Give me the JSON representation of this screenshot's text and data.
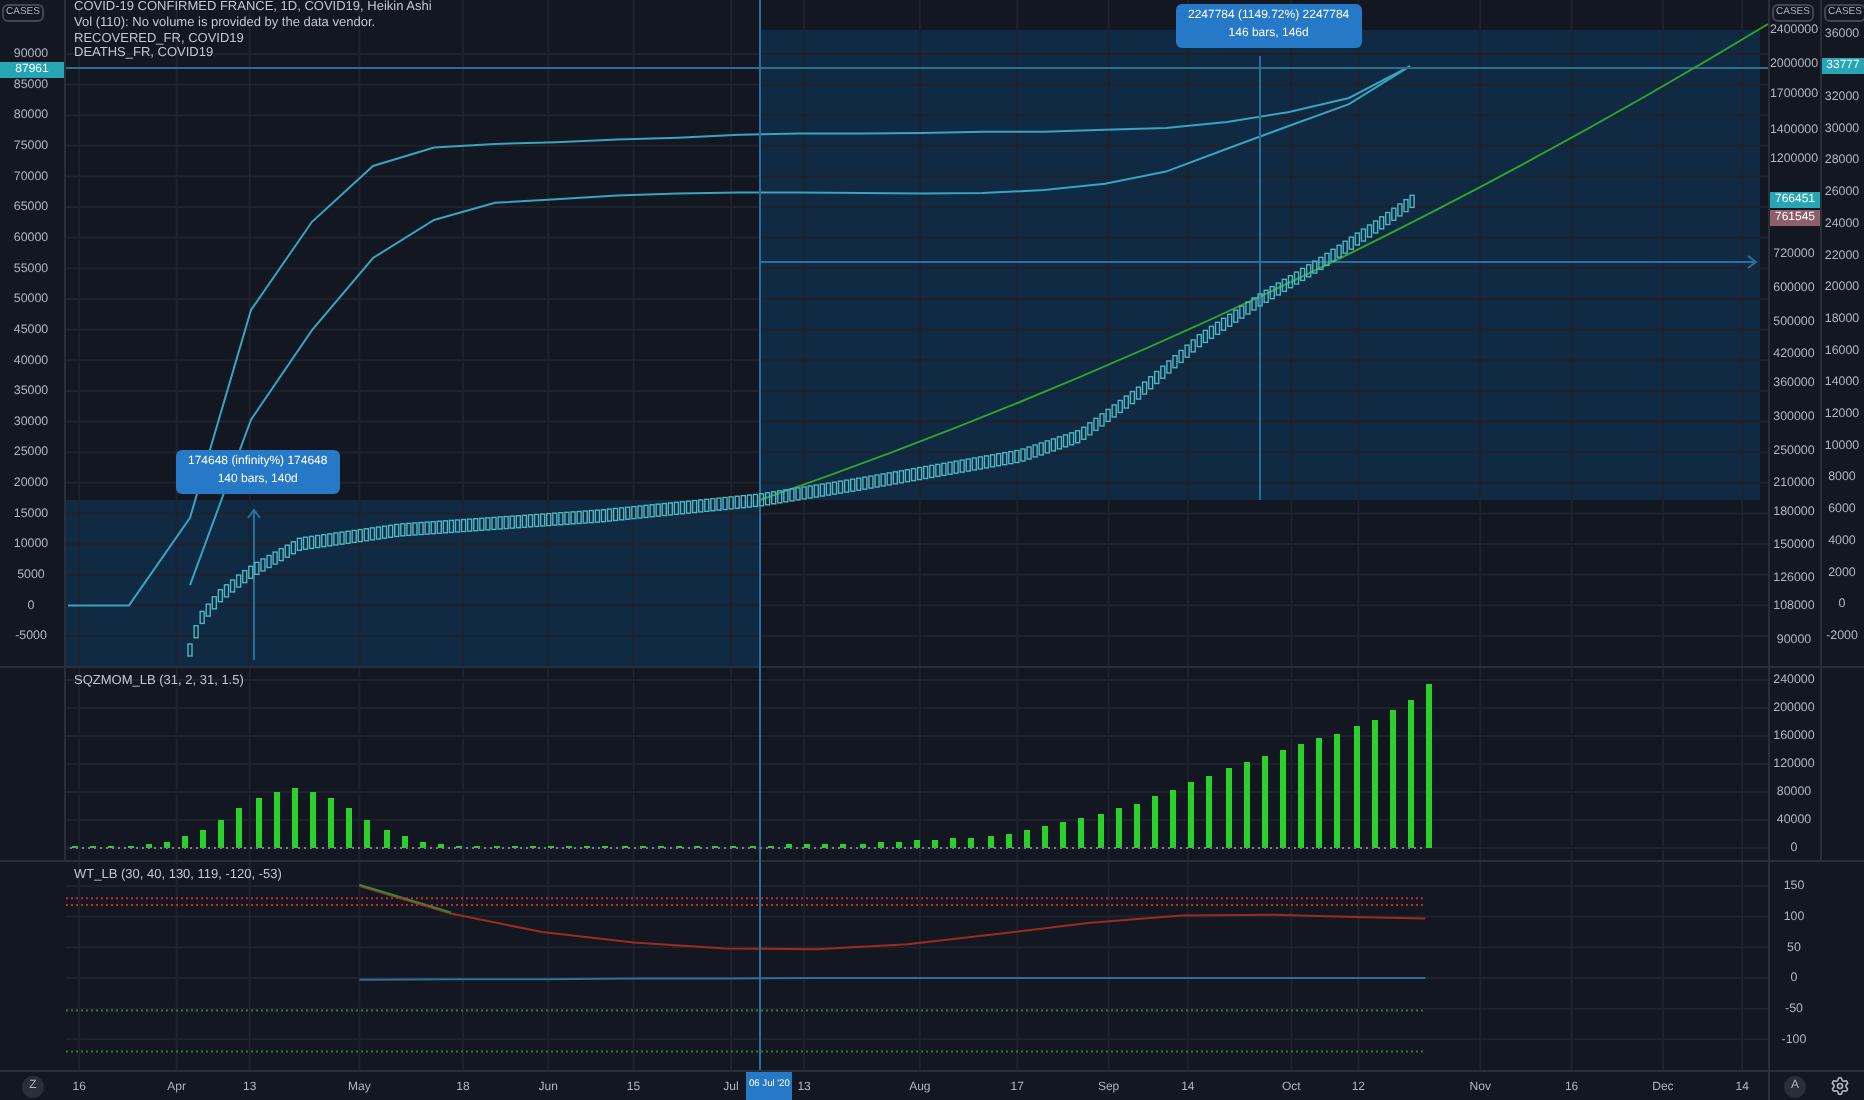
{
  "main_pane": {
    "legend": [
      "COVID-19 CONFIRMED FRANCE, 1D, COVID19, Heikin Ashi",
      "Vol (110): No volume is provided by the data vendor.",
      "RECOVERED_FR, COVID19",
      "DEATHS_FR, COVID19"
    ],
    "left_axis": {
      "unit": "CASES",
      "badge": "87961"
    },
    "chart_data": {
      "type": "line",
      "grid": true,
      "ylim": [
        -9900,
        98800
      ],
      "categories": [
        null,
        null,
        null,
        null,
        null,
        null,
        null,
        null,
        null,
        null,
        null,
        null,
        null,
        null,
        null,
        null,
        null,
        null,
        null,
        null,
        null,
        null,
        null
      ],
      "series": [
        {
          "color": "#3aa3c0",
          "values": [
            0,
            0,
            14300,
            48200,
            62600,
            71700,
            74700,
            75300,
            75600,
            76000,
            76300,
            76800,
            77000,
            77000,
            77100,
            77300,
            77300,
            77600,
            77900,
            78900,
            80500,
            82800,
            88000
          ]
        },
        {
          "color": "#3aa3c0",
          "values": [
            null,
            null,
            3300,
            30300,
            44900,
            56700,
            62900,
            65700,
            66300,
            66900,
            67200,
            67400,
            67400,
            67300,
            67200,
            67300,
            67800,
            68800,
            70800,
            74500,
            78200,
            81800,
            88000
          ]
        }
      ],
      "yticks": [
        {
          "value": 90000,
          "label": "90000"
        },
        {
          "value": 85000,
          "label": "85000"
        },
        {
          "value": 80000,
          "label": "80000"
        },
        {
          "value": 75000,
          "label": "75000"
        },
        {
          "value": 70000,
          "label": "70000"
        },
        {
          "value": 65000,
          "label": "65000"
        },
        {
          "value": 60000,
          "label": "60000"
        },
        {
          "value": 55000,
          "label": "55000"
        },
        {
          "value": 50000,
          "label": "50000"
        },
        {
          "value": 45000,
          "label": "45000"
        },
        {
          "value": 40000,
          "label": "40000"
        },
        {
          "value": 35000,
          "label": "35000"
        },
        {
          "value": 30000,
          "label": "30000"
        },
        {
          "value": 25000,
          "label": "25000"
        },
        {
          "value": 20000,
          "label": "20000"
        },
        {
          "value": 15000,
          "label": "15000"
        },
        {
          "value": 10000,
          "label": "10000"
        },
        {
          "value": 5000,
          "label": "5000"
        },
        {
          "value": 0,
          "label": "0"
        },
        {
          "value": -5000,
          "label": "-5000"
        }
      ]
    },
    "center_axis": {
      "unit": "CASES",
      "labels": [
        "2400000",
        "2000000",
        "1700000",
        "1400000",
        "1200000",
        "720000",
        "600000",
        "500000",
        "420000",
        "360000",
        "300000",
        "250000",
        "210000",
        "180000",
        "150000",
        "126000",
        "108000",
        "90000"
      ],
      "badges": [
        {
          "text": "766451",
          "color": "#26a6b5"
        },
        {
          "text": "761545",
          "color": "#8e5f6a"
        }
      ]
    },
    "right_axis": {
      "unit": "CASES",
      "badge": "33777",
      "labels": [
        "36000",
        "32000",
        "30000",
        "28000",
        "26000",
        "24000",
        "22000",
        "20000",
        "18000",
        "16000",
        "14000",
        "12000",
        "10000",
        "8000",
        "6000",
        "4000",
        "2000",
        "0",
        "-2000"
      ]
    },
    "tooltips": [
      {
        "value": "2247784 (1149.72%) 2247784",
        "range": "146 bars, 146d"
      },
      {
        "value": "174648 (infinity%) 174648",
        "range": "140 bars, 140d"
      }
    ]
  },
  "squeeze_pane": {
    "title": "SQZMOM_LB (31, 2, 31, 1.5)",
    "chart_data": {
      "type": "bar",
      "grid": true,
      "ylim": [
        -17143,
        257143
      ],
      "categories": [
        null,
        null,
        null,
        null,
        null,
        null,
        null,
        null,
        null,
        null,
        null,
        null,
        null,
        null,
        null,
        null,
        null,
        null,
        null,
        null,
        null,
        null,
        null,
        null,
        null,
        null,
        null,
        null,
        null,
        null,
        null,
        null,
        null,
        null,
        null,
        null,
        null,
        null,
        null,
        null,
        null,
        null,
        null,
        null,
        null,
        null,
        null,
        null,
        null,
        null,
        null,
        null,
        null,
        null,
        null,
        null,
        null,
        null,
        null,
        null,
        null,
        null,
        null,
        null,
        null,
        null,
        null,
        null,
        null,
        null,
        null,
        null,
        null,
        null,
        null,
        null,
        null,
        null,
        null,
        null,
        null,
        null,
        null,
        null,
        null,
        null,
        null,
        null,
        null,
        null,
        null,
        null,
        null
      ],
      "series": [
        {
          "color": "#2bd12b",
          "values": [
            3000,
            3000,
            3000,
            3000,
            5000,
            9000,
            16000,
            27000,
            41000,
            56000,
            71000,
            81000,
            85000,
            81000,
            71000,
            56000,
            41000,
            27000,
            16000,
            9000,
            5000,
            3000,
            3000,
            3000,
            3000,
            3000,
            3000,
            3000,
            3000,
            3000,
            3000,
            3000,
            3000,
            3000,
            3000,
            3000,
            3000,
            4000,
            4000,
            5000,
            5000,
            6000,
            6000,
            7000,
            8000,
            9000,
            10000,
            11000,
            13000,
            14000,
            17000,
            21000,
            26000,
            31000,
            36000,
            42000,
            49000,
            56000,
            64000,
            73000,
            83000,
            94000,
            104000,
            113000,
            122000,
            131000,
            140000,
            148000,
            156000,
            164000,
            173000,
            183000,
            196000,
            212000,
            235000,
            null,
            null,
            null,
            null,
            null,
            null,
            null,
            null,
            null,
            null,
            null,
            null,
            null,
            null,
            null,
            null,
            null,
            null
          ]
        }
      ],
      "yticks": [
        {
          "value": 240000,
          "label": "240000"
        },
        {
          "value": 200000,
          "label": "200000"
        },
        {
          "value": 160000,
          "label": "160000"
        },
        {
          "value": 120000,
          "label": "120000"
        },
        {
          "value": 80000,
          "label": "80000"
        },
        {
          "value": 40000,
          "label": "40000"
        },
        {
          "value": 0,
          "label": "0"
        }
      ]
    }
  },
  "wave_pane": {
    "title": "WT_LB (30, 40, 130, 119, -120, -53)",
    "chart_data": {
      "type": "line",
      "grid": true,
      "xlim": [
        "2020-03-03",
        "2021-01-03"
      ],
      "ylim": [
        -150,
        189
      ],
      "x": [
        "2020-05-01",
        "2020-05-16",
        "2020-05-31",
        "2020-06-15",
        "2020-06-30",
        "2020-07-15",
        "2020-07-30",
        "2020-08-14",
        "2020-08-29",
        "2020-09-13",
        "2020-09-28",
        "2020-10-13",
        "2020-10-23"
      ],
      "series": [
        {
          "color": "#9c2b22",
          "values": [
            150,
            105,
            75,
            58,
            48,
            47,
            55,
            72,
            90,
            102,
            103,
            99,
            97
          ]
        },
        {
          "color": "#2e8b3a",
          "values": [
            152,
            107,
            null,
            null,
            null,
            null,
            null,
            null,
            null,
            null,
            null,
            null,
            null
          ]
        },
        {
          "color": "#2f6fa0",
          "values": [
            -3,
            -2,
            -2,
            -1,
            -1,
            0,
            0,
            0,
            0,
            0,
            0,
            0,
            0
          ]
        }
      ],
      "yticks": [
        {
          "value": 150,
          "label": "150"
        },
        {
          "value": 100,
          "label": "100"
        },
        {
          "value": 50,
          "label": "50"
        },
        {
          "value": 0,
          "label": "0"
        },
        {
          "value": -50,
          "label": "-50"
        },
        {
          "value": -100,
          "label": "-100"
        }
      ],
      "xticks": [
        {
          "value": "2020-03-16",
          "label": "16"
        },
        {
          "value": "2020-04-01",
          "label": "Apr"
        },
        {
          "value": "2020-04-13",
          "label": "13"
        },
        {
          "value": "2020-05-01",
          "label": "May"
        },
        {
          "value": "2020-05-18",
          "label": "18"
        },
        {
          "value": "2020-06-01",
          "label": "Jun"
        },
        {
          "value": "2020-06-15",
          "label": "15"
        },
        {
          "value": "2020-07-01",
          "label": "Jul"
        },
        {
          "value": "2020-07-13",
          "label": "13"
        },
        {
          "value": "2020-08-01",
          "label": "Aug"
        },
        {
          "value": "2020-08-17",
          "label": "17"
        },
        {
          "value": "2020-09-01",
          "label": "Sep"
        },
        {
          "value": "2020-09-14",
          "label": "14"
        },
        {
          "value": "2020-10-01",
          "label": "Oct"
        },
        {
          "value": "2020-10-12",
          "label": "12"
        },
        {
          "value": "2020-11-01",
          "label": "Nov"
        },
        {
          "value": "2020-11-16",
          "label": "16"
        },
        {
          "value": "2020-12-01",
          "label": "Dec"
        },
        {
          "value": "2020-12-14",
          "label": "14"
        }
      ]
    }
  },
  "time_axis": {
    "cursor_label": "06 Jul '20",
    "left_button": "Z",
    "right_button": "A"
  }
}
